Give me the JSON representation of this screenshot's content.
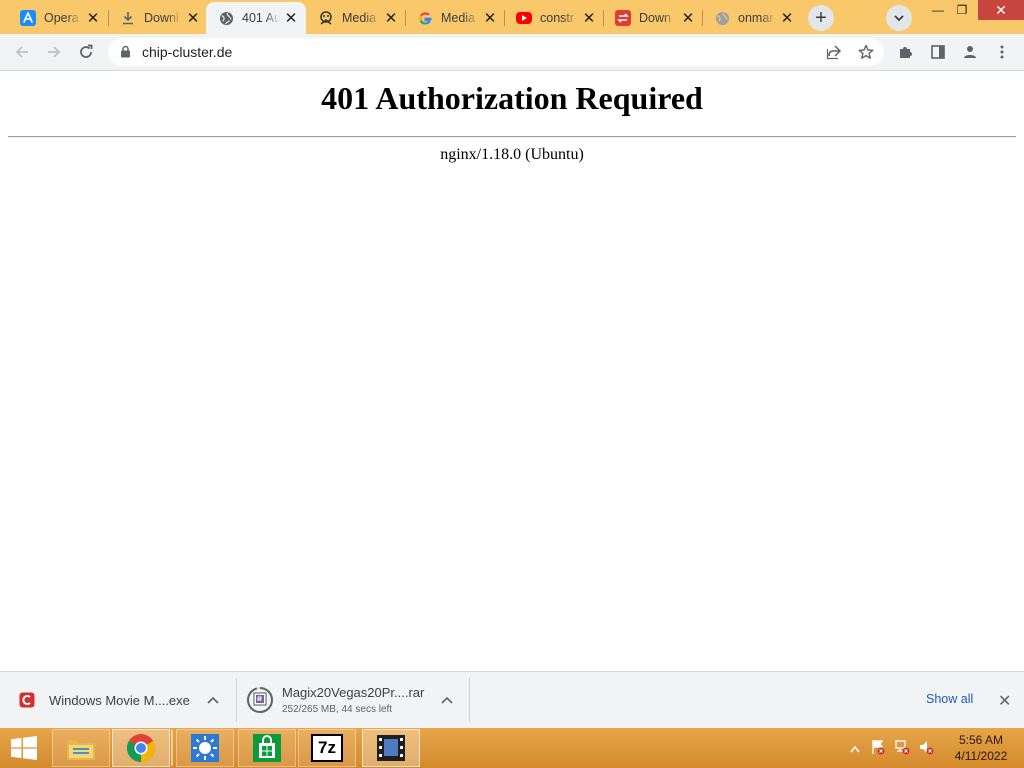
{
  "browser": {
    "tabs": [
      {
        "title": "Opera",
        "icon": "app-store-icon",
        "color": "#1a8cff",
        "active": false
      },
      {
        "title": "Downl",
        "icon": "download-icon",
        "color": "#5f6368",
        "active": false
      },
      {
        "title": "401 Au",
        "icon": "globe-icon",
        "color": "#5f6368",
        "active": true
      },
      {
        "title": "Media",
        "icon": "media-site-icon",
        "color": "#333333",
        "active": false
      },
      {
        "title": "Media",
        "icon": "google-icon",
        "color": "#4285f4",
        "active": false
      },
      {
        "title": "constr",
        "icon": "youtube-icon",
        "color": "#ff0000",
        "active": false
      },
      {
        "title": "Down",
        "icon": "red-arrows-icon",
        "color": "#e53935",
        "active": false
      },
      {
        "title": "onmar",
        "icon": "globe-icon",
        "color": "#9aa0a6",
        "active": false
      }
    ],
    "new_tab_label": "+",
    "window_controls": {
      "minimize": "—",
      "restore": "❐",
      "close": "✕"
    },
    "url": "chip-cluster.de"
  },
  "page": {
    "heading": "401 Authorization Required",
    "server": "nginx/1.18.0 (Ubuntu)"
  },
  "downloads": {
    "items": [
      {
        "name": "Windows Movie M....exe",
        "status": "",
        "icon": "exe-file-icon",
        "icon_color": "#d32f2f"
      },
      {
        "name": "Magix20Vegas20Pr....rar",
        "status": "252/265 MB, 44 secs left",
        "icon": "rar-file-icon",
        "icon_color": "#555555"
      }
    ],
    "show_all": "Show all",
    "close": "✕"
  },
  "taskbar": {
    "apps": [
      "file-explorer",
      "chrome",
      "weather-app",
      "store",
      "7zip",
      "movie-maker"
    ],
    "seven_zip_label": "7z",
    "clock_time": "5:56 AM",
    "clock_date": "4/11/2022"
  },
  "colors": {
    "tabstrip": "#f9c86b",
    "toolbar": "#f1f3f4",
    "taskbar": "#d9952f",
    "link": "#1a5bb8"
  }
}
